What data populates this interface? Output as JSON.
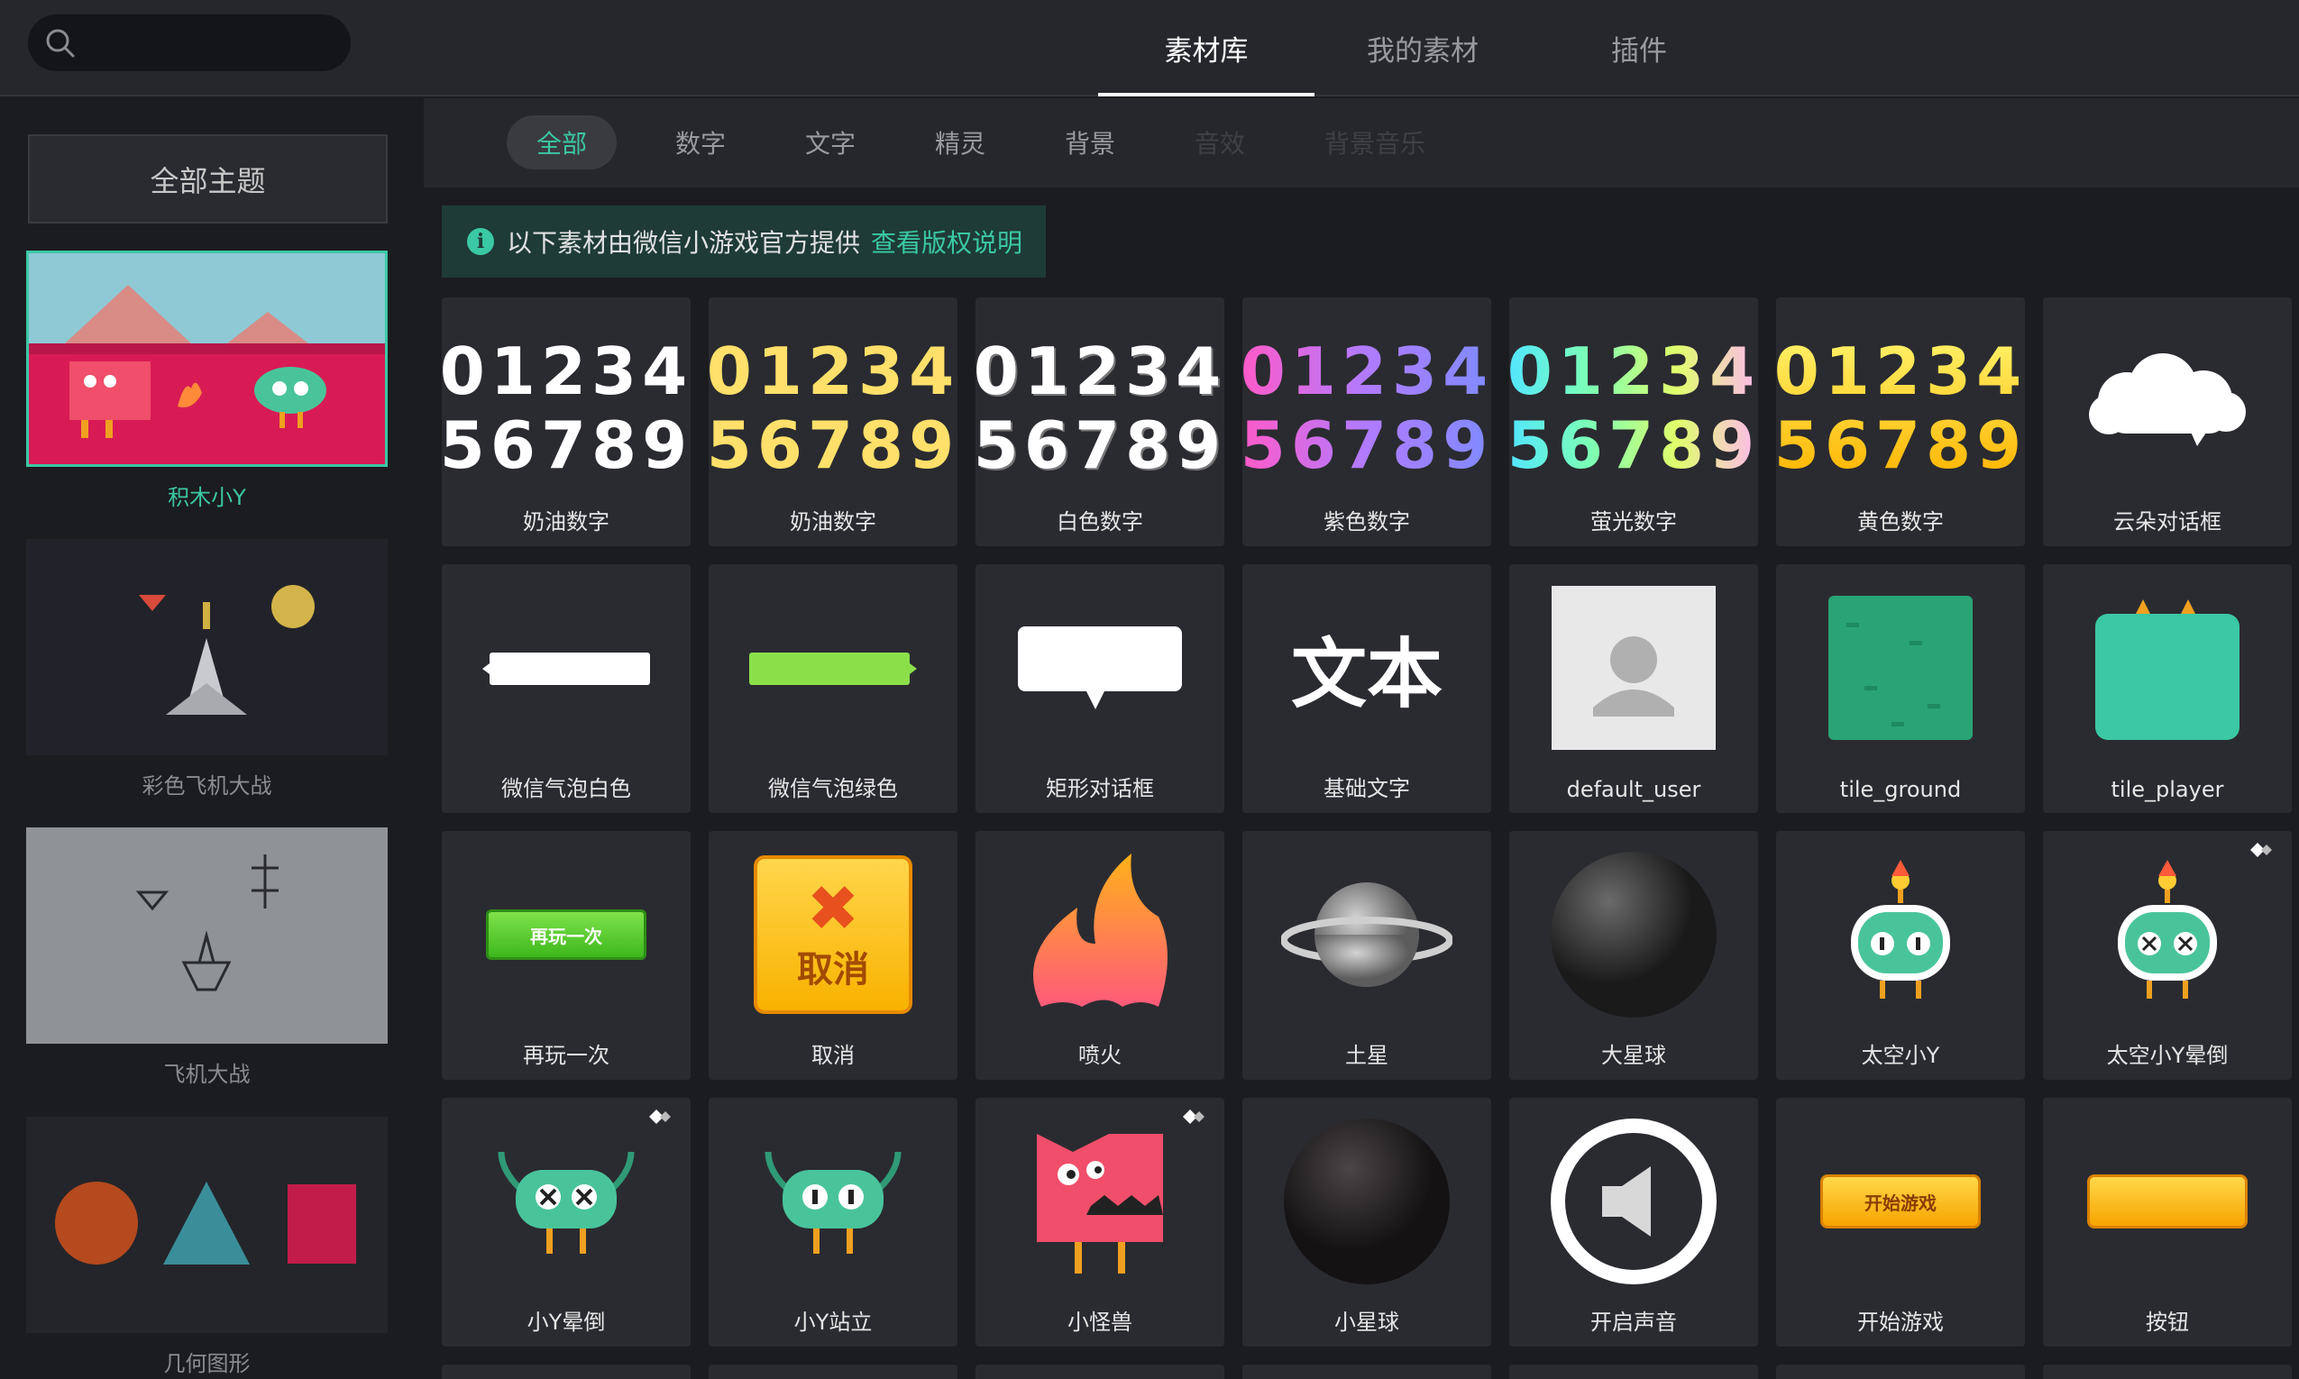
{
  "search": {
    "placeholder": ""
  },
  "top_tabs": [
    {
      "label": "素材库",
      "active": true
    },
    {
      "label": "我的素材",
      "active": false
    },
    {
      "label": "插件",
      "active": false
    }
  ],
  "sidebar": {
    "all_themes": "全部主题",
    "themes": [
      {
        "label": "积木小Y",
        "selected": true
      },
      {
        "label": "彩色飞机大战",
        "selected": false
      },
      {
        "label": "飞机大战",
        "selected": false
      },
      {
        "label": "几何图形",
        "selected": false
      }
    ]
  },
  "filters": [
    {
      "label": "全部",
      "state": "active"
    },
    {
      "label": "数字",
      "state": "normal"
    },
    {
      "label": "文字",
      "state": "normal"
    },
    {
      "label": "精灵",
      "state": "normal"
    },
    {
      "label": "背景",
      "state": "normal"
    },
    {
      "label": "音效",
      "state": "disabled"
    },
    {
      "label": "背景音乐",
      "state": "disabled"
    }
  ],
  "notice": {
    "text": "以下素材由微信小游戏官方提供",
    "link": "查看版权说明"
  },
  "assets": [
    {
      "name": "奶油数字",
      "kind": "digits",
      "style": "white",
      "line1": "01234",
      "line2": "56789"
    },
    {
      "name": "奶油数字",
      "kind": "digits",
      "style": "yellow",
      "line1": "01234",
      "line2": "56789"
    },
    {
      "name": "白色数字",
      "kind": "digits",
      "style": "gray",
      "line1": "01234",
      "line2": "56789"
    },
    {
      "name": "紫色数字",
      "kind": "digits",
      "style": "purple",
      "line1": "01234",
      "line2": "56789"
    },
    {
      "name": "萤光数字",
      "kind": "digits",
      "style": "fluor",
      "line1": "01234",
      "line2": "56789"
    },
    {
      "name": "黄色数字",
      "kind": "digits",
      "style": "gold",
      "line1": "01234",
      "line2": "56789"
    },
    {
      "name": "云朵对话框",
      "kind": "cloud"
    },
    {
      "name": "微信气泡白色",
      "kind": "bubble-white"
    },
    {
      "name": "微信气泡绿色",
      "kind": "bubble-green"
    },
    {
      "name": "矩形对话框",
      "kind": "rect-dialog"
    },
    {
      "name": "基础文字",
      "kind": "text",
      "text": "文本"
    },
    {
      "name": "default_user",
      "kind": "user"
    },
    {
      "name": "tile_ground",
      "kind": "tile-ground"
    },
    {
      "name": "tile_player",
      "kind": "tile-player"
    },
    {
      "name": "再玩一次",
      "kind": "btn-green",
      "text": "再玩一次"
    },
    {
      "name": "取消",
      "kind": "cancel",
      "text": "取消"
    },
    {
      "name": "喷火",
      "kind": "fire"
    },
    {
      "name": "土星",
      "kind": "saturn"
    },
    {
      "name": "大星球",
      "kind": "planet"
    },
    {
      "name": "太空小Y",
      "kind": "space-y"
    },
    {
      "name": "太空小Y晕倒",
      "kind": "space-y-dizzy",
      "badge": true
    },
    {
      "name": "小Y晕倒",
      "kind": "y-dizzy",
      "badge": true
    },
    {
      "name": "小Y站立",
      "kind": "y-stand"
    },
    {
      "name": "小怪兽",
      "kind": "monster",
      "badge": true
    },
    {
      "name": "小星球",
      "kind": "small-planet"
    },
    {
      "name": "开启声音",
      "kind": "sound"
    },
    {
      "name": "开始游戏",
      "kind": "btn-orange",
      "text": "开始游戏"
    },
    {
      "name": "按钮",
      "kind": "btn-orange-blank",
      "text": ""
    }
  ],
  "colors": {
    "accent": "#3bc8a5",
    "background": "#1b1c20",
    "panel": "#26272c",
    "card": "#2a2b30"
  }
}
